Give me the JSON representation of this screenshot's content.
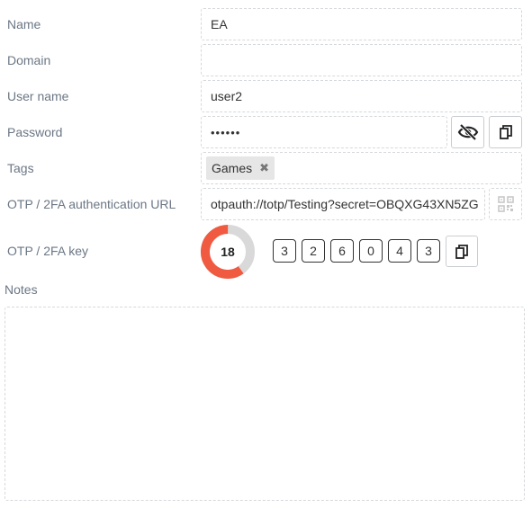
{
  "fields": {
    "name": {
      "label": "Name",
      "value": "EA"
    },
    "domain": {
      "label": "Domain",
      "value": ""
    },
    "username": {
      "label": "User name",
      "value": "user2"
    },
    "password": {
      "label": "Password",
      "value": "••••••"
    },
    "tags": {
      "label": "Tags",
      "items": [
        "Games"
      ]
    },
    "otp_url": {
      "label": "OTP / 2FA authentication URL",
      "value": "otpauth://totp/Testing?secret=OBQXG43XN5ZG"
    },
    "otp_key": {
      "label": "OTP / 2FA key",
      "countdown": "18",
      "countdown_fraction": 0.6,
      "digits": [
        "3",
        "2",
        "6",
        "0",
        "4",
        "3"
      ]
    }
  },
  "notes": {
    "label": "Notes",
    "value": ""
  },
  "colors": {
    "timer_remaining": "#f05a40",
    "timer_track": "#d9d9d9"
  },
  "icons": {
    "password_toggle": "eye-slash-icon",
    "copy": "copy-icon",
    "qr": "qr-code-icon",
    "tag_remove": "close-icon"
  }
}
